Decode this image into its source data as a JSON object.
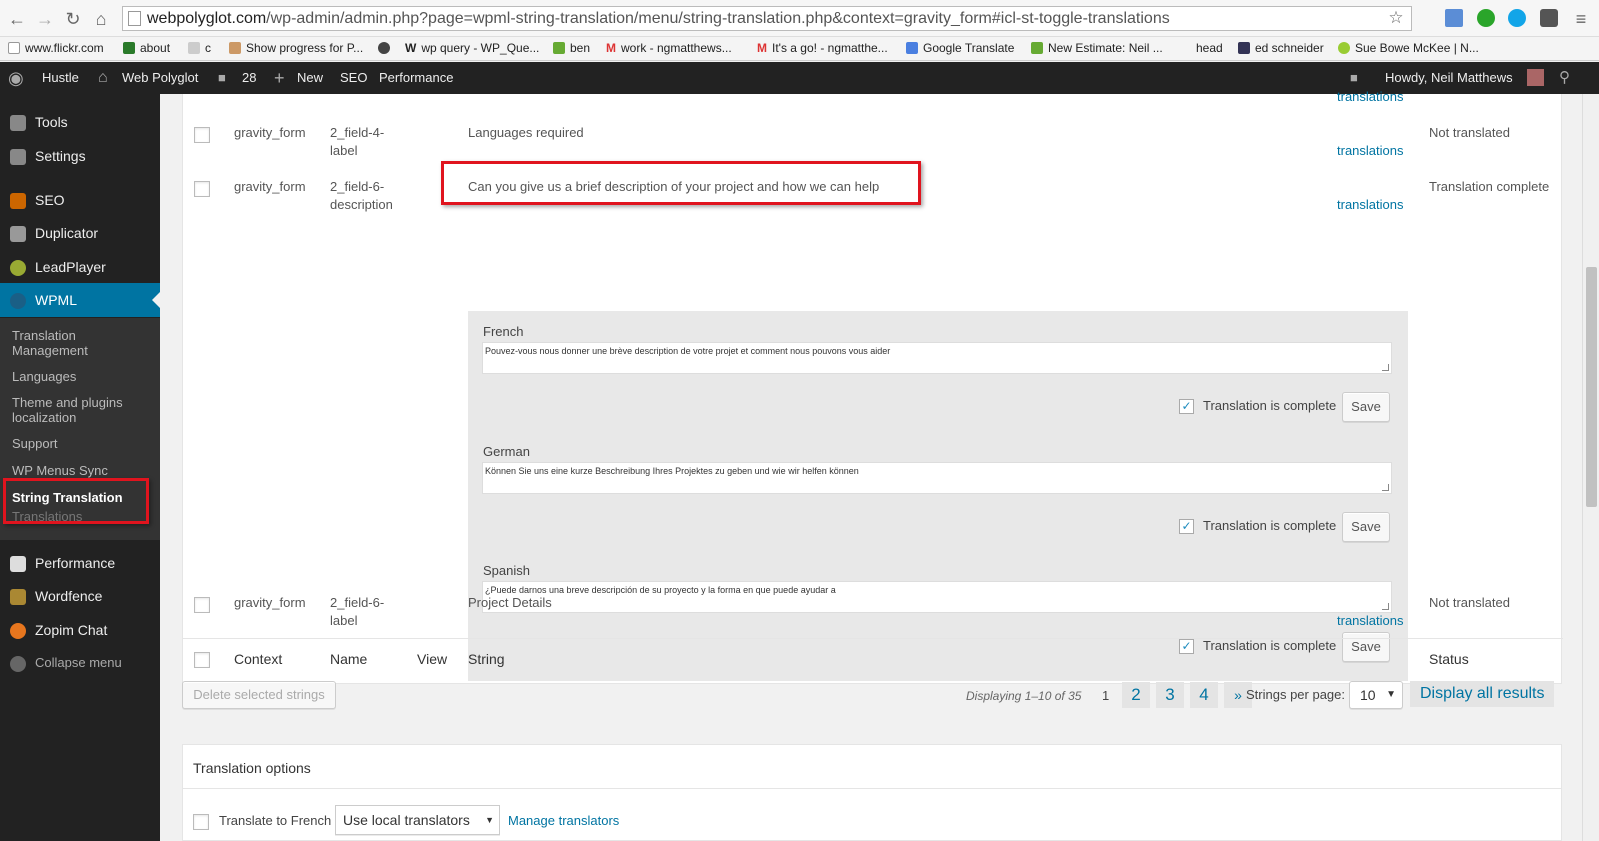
{
  "browser": {
    "url_host": "webpolyglot.com",
    "url_path": "/wp-admin/admin.php?page=wpml-string-translation/menu/string-translation.php&context=gravity_form#icl-st-toggle-translations"
  },
  "bookmarks": [
    "www.flickr.com",
    "about",
    "c",
    "Show progress for P...",
    "wp query - WP_Que...",
    "ben",
    "work - ngmatthews...",
    "It's a go! - ngmatthe...",
    "Google Translate",
    "New Estimate: Neil ...",
    "head",
    "ed schneider",
    "Sue Bowe McKee | N..."
  ],
  "adminbar": {
    "hustle": "Hustle",
    "site": "Web Polyglot",
    "comments": "28",
    "new": "New",
    "seo": "SEO",
    "performance": "Performance",
    "howdy": "Howdy, Neil Matthews"
  },
  "sidebar": {
    "items": [
      "Tools",
      "Settings",
      "SEO",
      "Duplicator",
      "LeadPlayer",
      "WPML",
      "Performance",
      "Wordfence",
      "Zopim Chat",
      "Collapse menu"
    ],
    "submenu": [
      "Translation Management",
      "Languages",
      "Theme and plugins localization",
      "Support",
      "WP Menus Sync",
      "String Translation",
      "Translations"
    ]
  },
  "table": {
    "top_link": "translations",
    "rows": [
      {
        "context": "gravity_form",
        "name": "2_field-4-label",
        "string": "Languages required",
        "link": "translations",
        "status": "Not translated"
      },
      {
        "context": "gravity_form",
        "name": "2_field-6-description",
        "string": "Can you give us a brief description of your project and how we can help",
        "link": "translations",
        "status": "Translation complete"
      },
      {
        "context": "gravity_form",
        "name": "2_field-6-label",
        "string": "Project Details",
        "link": "translations",
        "status": "Not translated"
      }
    ],
    "translations": [
      {
        "lang": "French",
        "text": "Pouvez-vous nous donner une brève description de votre projet et comment nous pouvons vous aider",
        "complete_label": "Translation is complete",
        "save": "Save"
      },
      {
        "lang": "German",
        "text": "Können Sie uns eine kurze Beschreibung Ihres Projektes zu geben und wie wir helfen können",
        "complete_label": "Translation is complete",
        "save": "Save"
      },
      {
        "lang": "Spanish",
        "text": "¿Puede darnos una breve descripción de su proyecto y la forma en que puede ayudar a",
        "complete_label": "Translation is complete",
        "save": "Save"
      }
    ],
    "footer": {
      "context": "Context",
      "name": "Name",
      "view": "View",
      "string": "String",
      "status": "Status"
    }
  },
  "bottom": {
    "delete_btn": "Delete selected strings",
    "displaying": "Displaying 1–10 of 35",
    "current_page": "1",
    "pages": [
      "2",
      "3",
      "4",
      "»"
    ],
    "per_page_label": "Strings per page:",
    "per_page_value": "10",
    "display_all": "Display all results"
  },
  "options": {
    "title": "Translation options",
    "translate_to": "Translate to French",
    "translators_select": "Use local translators",
    "manage": "Manage translators"
  },
  "colors": {
    "wp_blue": "#0074a2",
    "highlight_red": "#e0141e",
    "adminbar": "#222222"
  }
}
